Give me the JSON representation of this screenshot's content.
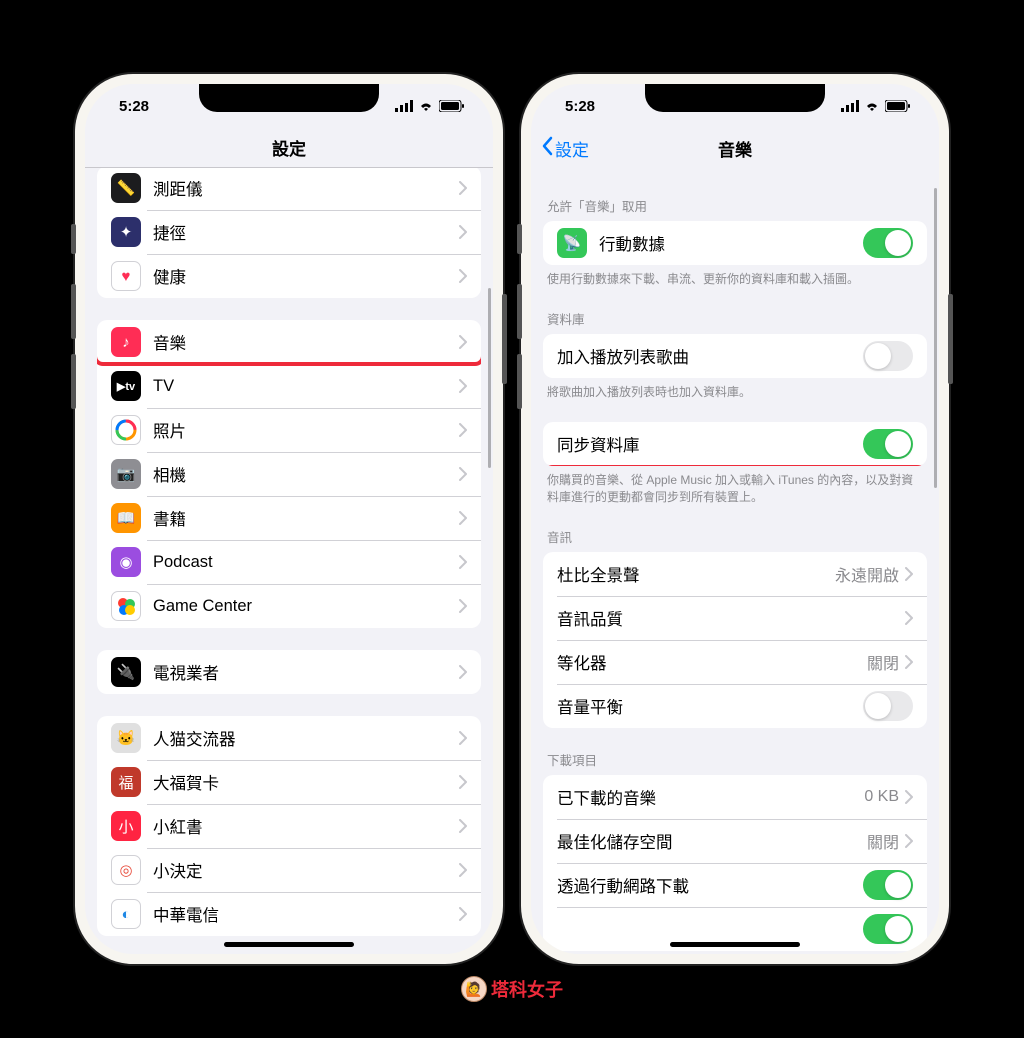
{
  "status": {
    "time": "5:28"
  },
  "left": {
    "title": "設定",
    "groups": [
      {
        "rows": [
          {
            "label": "測距儀",
            "icon_bg": "#1c1c1e",
            "glyph": "📏"
          },
          {
            "label": "捷徑",
            "icon_bg": "#2c2f6b",
            "glyph": "✦"
          },
          {
            "label": "健康",
            "icon_bg": "#ffffff",
            "glyph": "♥",
            "glyph_color": "#ff2d55",
            "border": true
          }
        ]
      },
      {
        "rows": [
          {
            "label": "音樂",
            "icon_bg": "#ff2d55",
            "glyph": "♪",
            "highlight": true
          },
          {
            "label": "TV",
            "icon_bg": "#000000",
            "glyph": "tv",
            "tv": true
          },
          {
            "label": "照片",
            "icon_bg": "#ffffff",
            "glyph": "❁",
            "rainbow": true,
            "border": true
          },
          {
            "label": "相機",
            "icon_bg": "#8e8e93",
            "glyph": "📷"
          },
          {
            "label": "書籍",
            "icon_bg": "#ff9500",
            "glyph": "📖"
          },
          {
            "label": "Podcast",
            "icon_bg": "#9b4de0",
            "glyph": "◉"
          },
          {
            "label": "Game Center",
            "icon_bg": "#ffffff",
            "glyph": "●",
            "game": true,
            "border": true
          }
        ]
      },
      {
        "rows": [
          {
            "label": "電視業者",
            "icon_bg": "#000000",
            "glyph": "🔌"
          }
        ]
      },
      {
        "rows": [
          {
            "label": "人猫交流器",
            "icon_bg": "#e0e0e0",
            "glyph": "🐱"
          },
          {
            "label": "大福賀卡",
            "icon_bg": "#c0392b",
            "glyph": "福"
          },
          {
            "label": "小紅書",
            "icon_bg": "#ff2442",
            "glyph": "小"
          },
          {
            "label": "小決定",
            "icon_bg": "#ffffff",
            "glyph": "◎",
            "glyph_color": "#e74c3c",
            "border": true
          },
          {
            "label": "中華電信",
            "icon_bg": "#ffffff",
            "glyph": "◐",
            "glyph_color": "#1e88e5",
            "border": true
          }
        ]
      }
    ]
  },
  "right": {
    "back": "設定",
    "title": "音樂",
    "sections": [
      {
        "header": "允許「音樂」取用",
        "rows": [
          {
            "label": "行動數據",
            "icon_bg": "#34c759",
            "glyph": "📡",
            "toggle": "on"
          }
        ],
        "footer": "使用行動數據來下載、串流、更新你的資料庫和載入插圖。"
      },
      {
        "header": "資料庫",
        "rows": [
          {
            "label": "加入播放列表歌曲",
            "toggle": "off"
          }
        ],
        "footer": "將歌曲加入播放列表時也加入資料庫。"
      },
      {
        "rows": [
          {
            "label": "同步資料庫",
            "toggle": "on",
            "highlight": true
          }
        ],
        "footer": "你購買的音樂、從 Apple Music 加入或輸入 iTunes 的內容，以及對資料庫進行的更動都會同步到所有裝置上。"
      },
      {
        "header": "音訊",
        "rows": [
          {
            "label": "杜比全景聲",
            "detail": "永遠開啟",
            "chevron": true
          },
          {
            "label": "音訊品質",
            "chevron": true
          },
          {
            "label": "等化器",
            "detail": "關閉",
            "chevron": true
          },
          {
            "label": "音量平衡",
            "toggle": "off"
          }
        ]
      },
      {
        "header": "下載項目",
        "rows": [
          {
            "label": "已下載的音樂",
            "detail": "0 KB",
            "chevron": true
          },
          {
            "label": "最佳化儲存空間",
            "detail": "關閉",
            "chevron": true
          },
          {
            "label": "透過行動網路下載",
            "toggle": "on"
          },
          {
            "label": "",
            "toggle": "on",
            "partial": true
          }
        ]
      }
    ]
  },
  "watermark": "塔科女子"
}
